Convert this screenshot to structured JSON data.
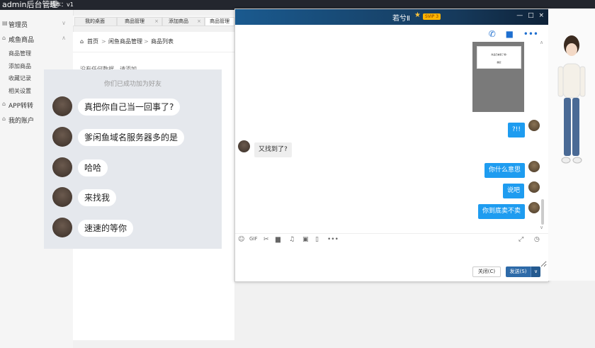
{
  "topbar": {
    "title": "admin后台管理",
    "version": "版本：v1"
  },
  "sidebar": {
    "items": [
      {
        "label": "管理员"
      },
      {
        "label": "咸鱼商品"
      },
      {
        "label": "APP转转"
      },
      {
        "label": "我的账户"
      }
    ],
    "sub_items": [
      {
        "label": "商品管理"
      },
      {
        "label": "添加商品"
      },
      {
        "label": "收藏记录"
      },
      {
        "label": "相关设置"
      }
    ]
  },
  "tabs": [
    {
      "label": "我的桌面"
    },
    {
      "label": "商品管理"
    },
    {
      "label": "添加商品"
    },
    {
      "label": "商品管理"
    }
  ],
  "breadcrumb": {
    "home": "首页",
    "level1": "闲鱼商品管理",
    "level2": "商品列表"
  },
  "content": {
    "empty_text": "没有任何数据，请添加"
  },
  "friend_panel": {
    "hint": "你们已成功加为好友",
    "messages": [
      {
        "text": "真把你自己当一回事了?"
      },
      {
        "text": "爹闲鱼域名服务器多的是"
      },
      {
        "text": "哈哈"
      },
      {
        "text": "来找我"
      },
      {
        "text": "速速的等你"
      }
    ]
  },
  "chat": {
    "contact_name": "若兮Ⅱ",
    "vip_label": "SVIP 3",
    "image_card": {
      "line1": "商品已被卖了哦!",
      "line2": "确定"
    },
    "messages": [
      {
        "side": "right",
        "text": "?!!"
      },
      {
        "side": "left",
        "text": "又找到了?"
      },
      {
        "side": "right",
        "text": "你什么意思"
      },
      {
        "side": "right",
        "text": "说吧"
      },
      {
        "side": "right",
        "text": "你到底卖不卖"
      }
    ],
    "input_placeholder": "",
    "close_label": "关闭(C)",
    "send_label": "发送(S)"
  }
}
